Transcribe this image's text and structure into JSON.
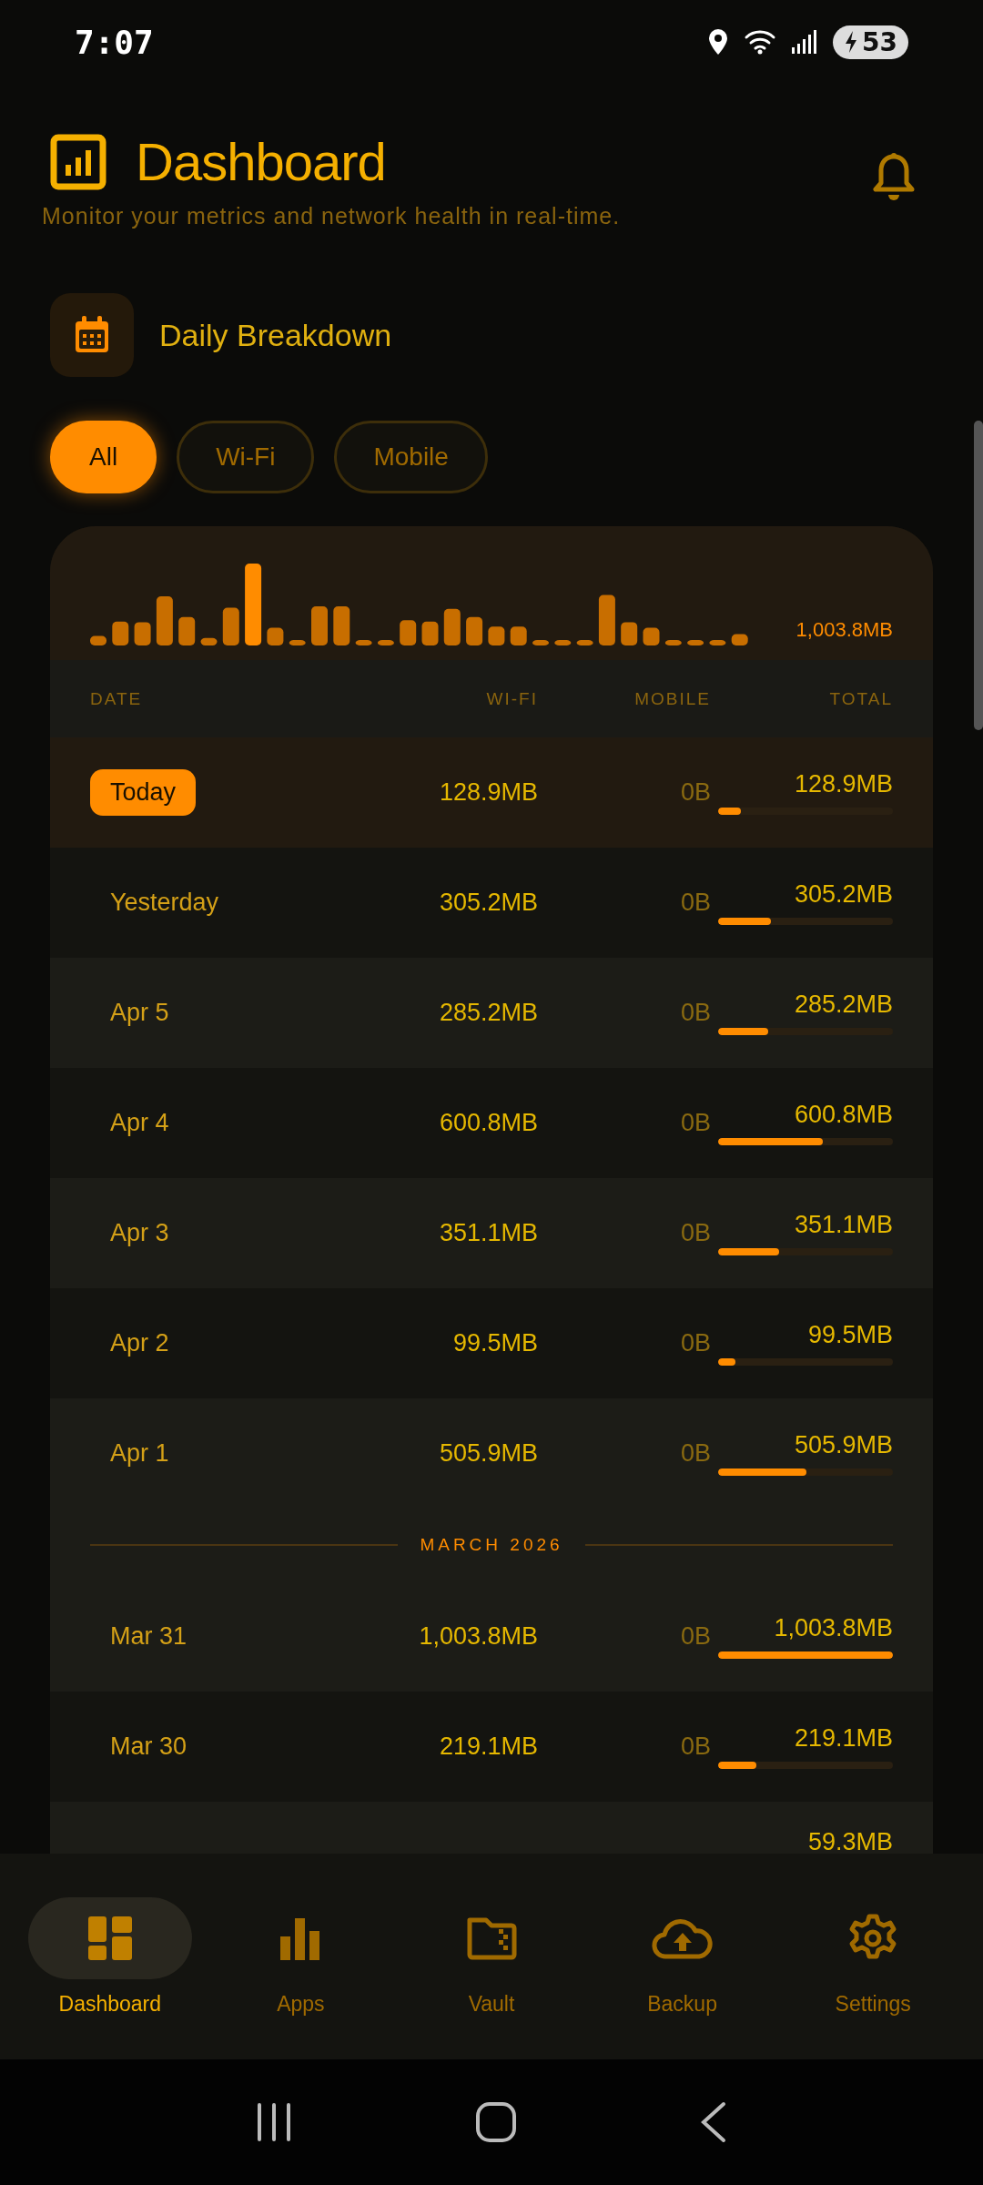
{
  "status_bar": {
    "time": "7:07",
    "battery": "53"
  },
  "header": {
    "title": "Dashboard",
    "subtitle": "Monitor your metrics and network health in real-time."
  },
  "section": {
    "title": "Daily Breakdown"
  },
  "filters": [
    {
      "label": "All",
      "selected": true
    },
    {
      "label": "Wi-Fi",
      "selected": false
    },
    {
      "label": "Mobile",
      "selected": false
    }
  ],
  "sparkline": {
    "peak": "1,003.8MB"
  },
  "table": {
    "columns": [
      "DATE",
      "WI-FI",
      "MOBILE",
      "TOTAL"
    ],
    "rows": [
      {
        "kind": "day",
        "date": "Today",
        "today": true,
        "wifi": "128.9MB",
        "mobile": "0B",
        "total": "128.9MB",
        "level": 0.128
      },
      {
        "kind": "day",
        "date": "Yesterday",
        "today": false,
        "wifi": "305.2MB",
        "mobile": "0B",
        "total": "305.2MB",
        "level": 0.304
      },
      {
        "kind": "day",
        "date": "Apr 5",
        "today": false,
        "wifi": "285.2MB",
        "mobile": "0B",
        "total": "285.2MB",
        "level": 0.284
      },
      {
        "kind": "day",
        "date": "Apr 4",
        "today": false,
        "wifi": "600.8MB",
        "mobile": "0B",
        "total": "600.8MB",
        "level": 0.599
      },
      {
        "kind": "day",
        "date": "Apr 3",
        "today": false,
        "wifi": "351.1MB",
        "mobile": "0B",
        "total": "351.1MB",
        "level": 0.35
      },
      {
        "kind": "day",
        "date": "Apr 2",
        "today": false,
        "wifi": "99.5MB",
        "mobile": "0B",
        "total": "99.5MB",
        "level": 0.099
      },
      {
        "kind": "day",
        "date": "Apr 1",
        "today": false,
        "wifi": "505.9MB",
        "mobile": "0B",
        "total": "505.9MB",
        "level": 0.504
      },
      {
        "kind": "month",
        "label": "MARCH 2026"
      },
      {
        "kind": "day",
        "date": "Mar 31",
        "today": false,
        "wifi": "1,003.8MB",
        "mobile": "0B",
        "total": "1,003.8MB",
        "level": 1.0
      },
      {
        "kind": "day",
        "date": "Mar 30",
        "today": false,
        "wifi": "219.1MB",
        "mobile": "0B",
        "total": "219.1MB",
        "level": 0.218
      },
      {
        "kind": "partial",
        "total": "59.3MB"
      }
    ]
  },
  "bottom_nav": [
    {
      "label": "Dashboard",
      "selected": true
    },
    {
      "label": "Apps",
      "selected": false
    },
    {
      "label": "Vault",
      "selected": false
    },
    {
      "label": "Backup",
      "selected": false
    },
    {
      "label": "Settings",
      "selected": false
    }
  ]
}
